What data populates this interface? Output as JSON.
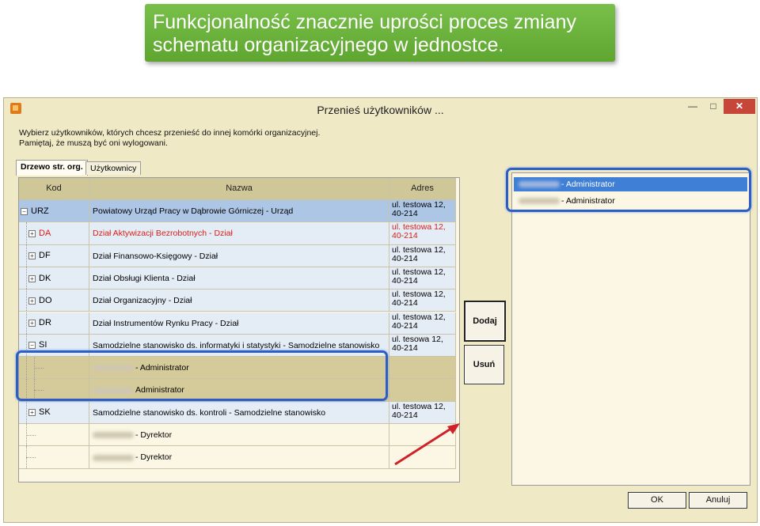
{
  "banner": {
    "line1": "Funkcjonalność znacznie uprości proces zmiany",
    "line2": "schematu organizacyjnego w jednostce."
  },
  "window": {
    "title": "Przenieś użytkowników ...",
    "minimize": "—",
    "maximize": "□",
    "close": "✕"
  },
  "info": {
    "line1": "Wybierz użytkowników, których chcesz przenieść do innej komórki organizacyjnej.",
    "line2": "Pamiętaj, że muszą być oni wylogowani."
  },
  "tabs": [
    "Drzewo str. org.",
    "Użytkownicy"
  ],
  "grid": {
    "columns": [
      "Kod",
      "Nazwa",
      "Adres"
    ],
    "rows": [
      {
        "code": "URZ",
        "name": "Powiatowy Urząd Pracy w Dąbrowie Górniczej - Urząd",
        "addr1": "ul. testowa 12,",
        "addr2": "40-214",
        "toggle": "−"
      },
      {
        "code": "DA",
        "name": "Dział Aktywizacji Bezrobotnych - Dział",
        "addr1": "ul. testowa 12,",
        "addr2": "40-214",
        "toggle": "+"
      },
      {
        "code": "DF",
        "name": "Dział Finansowo-Księgowy - Dział",
        "addr1": "ul. testowa 12,",
        "addr2": "40-214",
        "toggle": "+"
      },
      {
        "code": "DK",
        "name": "Dział Obsługi Klienta - Dział",
        "addr1": "ul. testowa 12,",
        "addr2": "40-214",
        "toggle": "+"
      },
      {
        "code": "DO",
        "name": "Dział Organizacyjny - Dział",
        "addr1": "ul. testowa 12,",
        "addr2": "40-214",
        "toggle": "+"
      },
      {
        "code": "DR",
        "name": "Dział Instrumentów Rynku Pracy - Dział",
        "addr1": "ul. testowa 12,",
        "addr2": "40-214",
        "toggle": "+"
      },
      {
        "code": "SI",
        "name": "Samodzielne stanowisko ds. informatyki i statystyki - Samodzielne stanowisko",
        "addr1": "ul. tesowa 12,",
        "addr2": "40-214",
        "toggle": "−"
      },
      {
        "code": "",
        "name": "- Administrator",
        "addr1": "",
        "addr2": "",
        "toggle": ""
      },
      {
        "code": "",
        "name": "Administrator",
        "addr1": "",
        "addr2": "",
        "toggle": ""
      },
      {
        "code": "SK",
        "name": "Samodzielne stanowisko ds. kontroli - Samodzielne stanowisko",
        "addr1": "ul. testowa 12,",
        "addr2": "40-214",
        "toggle": "+"
      },
      {
        "code": "",
        "name": "- Dyrektor",
        "addr1": "",
        "addr2": "",
        "toggle": ""
      },
      {
        "code": "",
        "name": "- Dyrektor",
        "addr1": "",
        "addr2": "",
        "toggle": ""
      }
    ]
  },
  "buttons": {
    "add": "Dodaj",
    "remove": "Usuń",
    "ok": "OK",
    "cancel": "Anuluj"
  },
  "selected_users": [
    {
      "label": "- Administrator"
    },
    {
      "label": "- Administrator"
    }
  ],
  "colors": {
    "banner": "#6ab33b",
    "highlight_border": "#2c5ec4",
    "arrow": "#d0202a",
    "red_row_text": "#d8201a",
    "selected_row": "#aec6e6",
    "user_row": "#d5cb9a"
  }
}
